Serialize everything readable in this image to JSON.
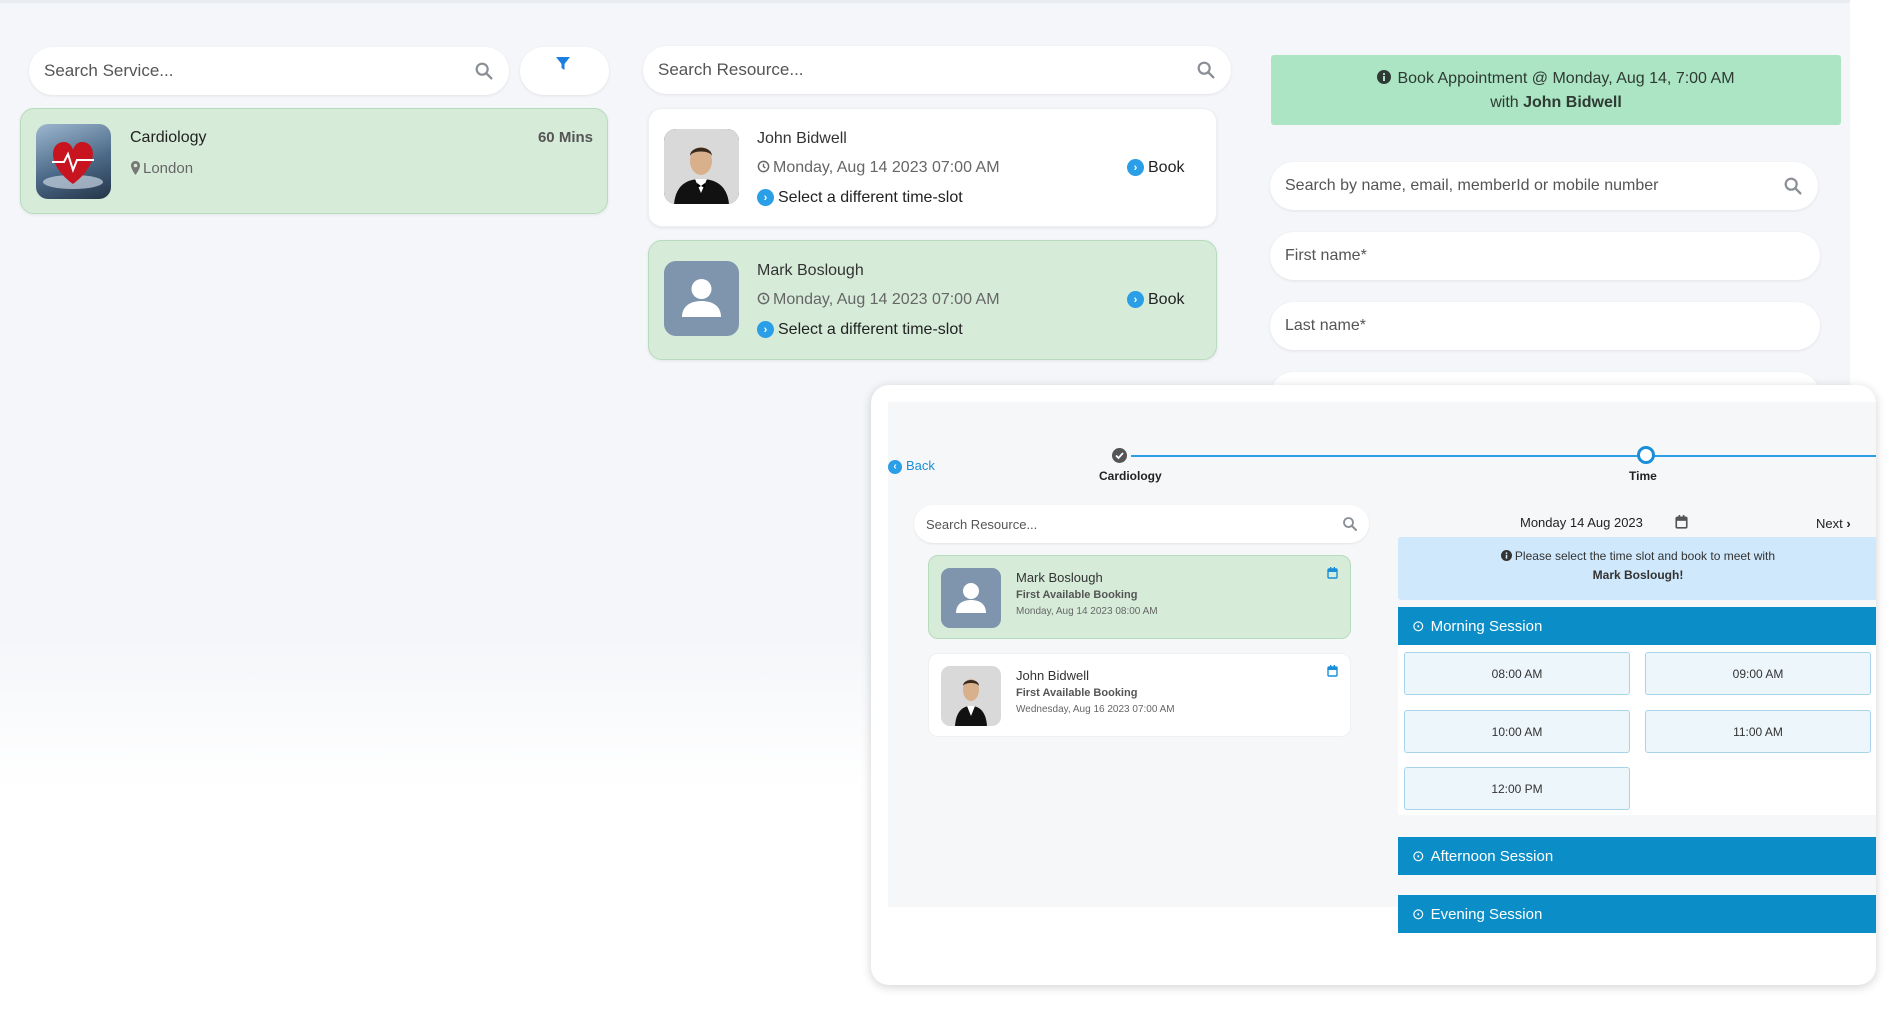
{
  "service_panel": {
    "search_placeholder": "Search Service...",
    "service": {
      "name": "Cardiology",
      "duration": "60 Mins",
      "location": "London"
    }
  },
  "resource_panel": {
    "search_placeholder": "Search Resource...",
    "resources": [
      {
        "name": "John Bidwell",
        "datetime": "Monday, Aug 14 2023 07:00 AM",
        "book_label": "Book",
        "alt_slot_label": "Select a different time-slot"
      },
      {
        "name": "Mark Boslough",
        "datetime": "Monday, Aug 14 2023 07:00 AM",
        "book_label": "Book",
        "alt_slot_label": "Select a different time-slot"
      }
    ]
  },
  "booking_panel": {
    "banner_line1": "Book Appointment @ Monday, Aug 14, 7:00 AM",
    "banner_with": "with",
    "banner_name": "John Bidwell",
    "member_search_placeholder": "Search by name, email, memberId or mobile number",
    "first_name_placeholder": "First name*",
    "last_name_placeholder": "Last name*"
  },
  "popup": {
    "back_label": "Back",
    "steps": [
      {
        "label": "Cardiology",
        "state": "done"
      },
      {
        "label": "Time",
        "state": "current"
      }
    ],
    "search_placeholder": "Search Resource...",
    "resources": [
      {
        "name": "Mark Boslough",
        "subtitle": "First Available Booking",
        "datetime": "Monday, Aug 14 2023 08:00 AM"
      },
      {
        "name": "John Bidwell",
        "subtitle": "First Available Booking",
        "datetime": "Wednesday, Aug 16 2023 07:00 AM"
      }
    ],
    "date_label": "Monday 14 Aug 2023",
    "next_label": "Next",
    "info_line1": "Please select the time slot and book to meet with",
    "info_name": "Mark Boslough!",
    "sessions": {
      "morning": "Morning Session",
      "afternoon": "Afternoon Session",
      "evening": "Evening Session"
    },
    "morning_slots": [
      "08:00 AM",
      "09:00 AM",
      "10:00 AM",
      "11:00 AM",
      "12:00 PM"
    ]
  },
  "colors": {
    "accent": "#0b8ec7",
    "selected_card": "#d6ecd9",
    "banner": "#abe5c3",
    "info": "#cfe8fb"
  }
}
